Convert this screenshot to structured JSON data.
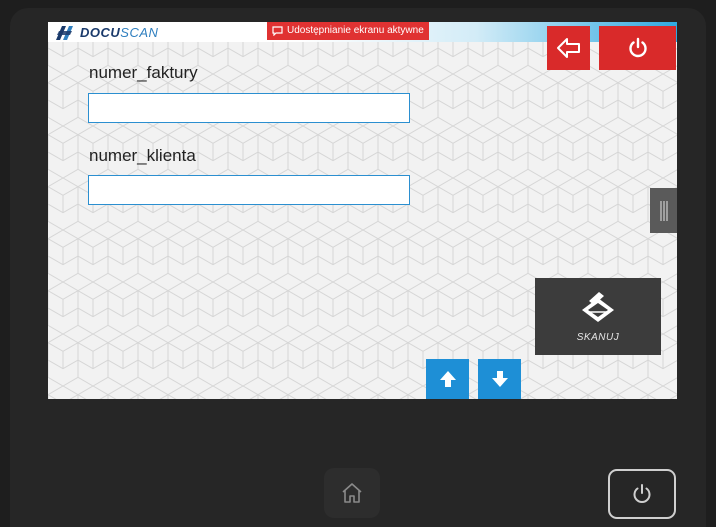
{
  "header": {
    "logo_bold": "DOCU",
    "logo_light": "SCAN",
    "screen_share_label": "Udostępnianie ekranu aktywne"
  },
  "form": {
    "fields": [
      {
        "label": "numer_faktury",
        "value": ""
      },
      {
        "label": "numer_klienta",
        "value": ""
      }
    ]
  },
  "scan": {
    "label": "SKANUJ"
  },
  "icons": {
    "back": "back-arrow-icon",
    "power": "power-icon",
    "scan": "scanner-icon",
    "up": "arrow-up-icon",
    "down": "arrow-down-icon",
    "home": "home-icon",
    "handle": "drag-handle-icon"
  },
  "colors": {
    "accent_red": "#d92a2a",
    "accent_blue": "#1e8fd6",
    "scan_button": "#3c3c3c",
    "brand_navy": "#1a3a6b"
  }
}
